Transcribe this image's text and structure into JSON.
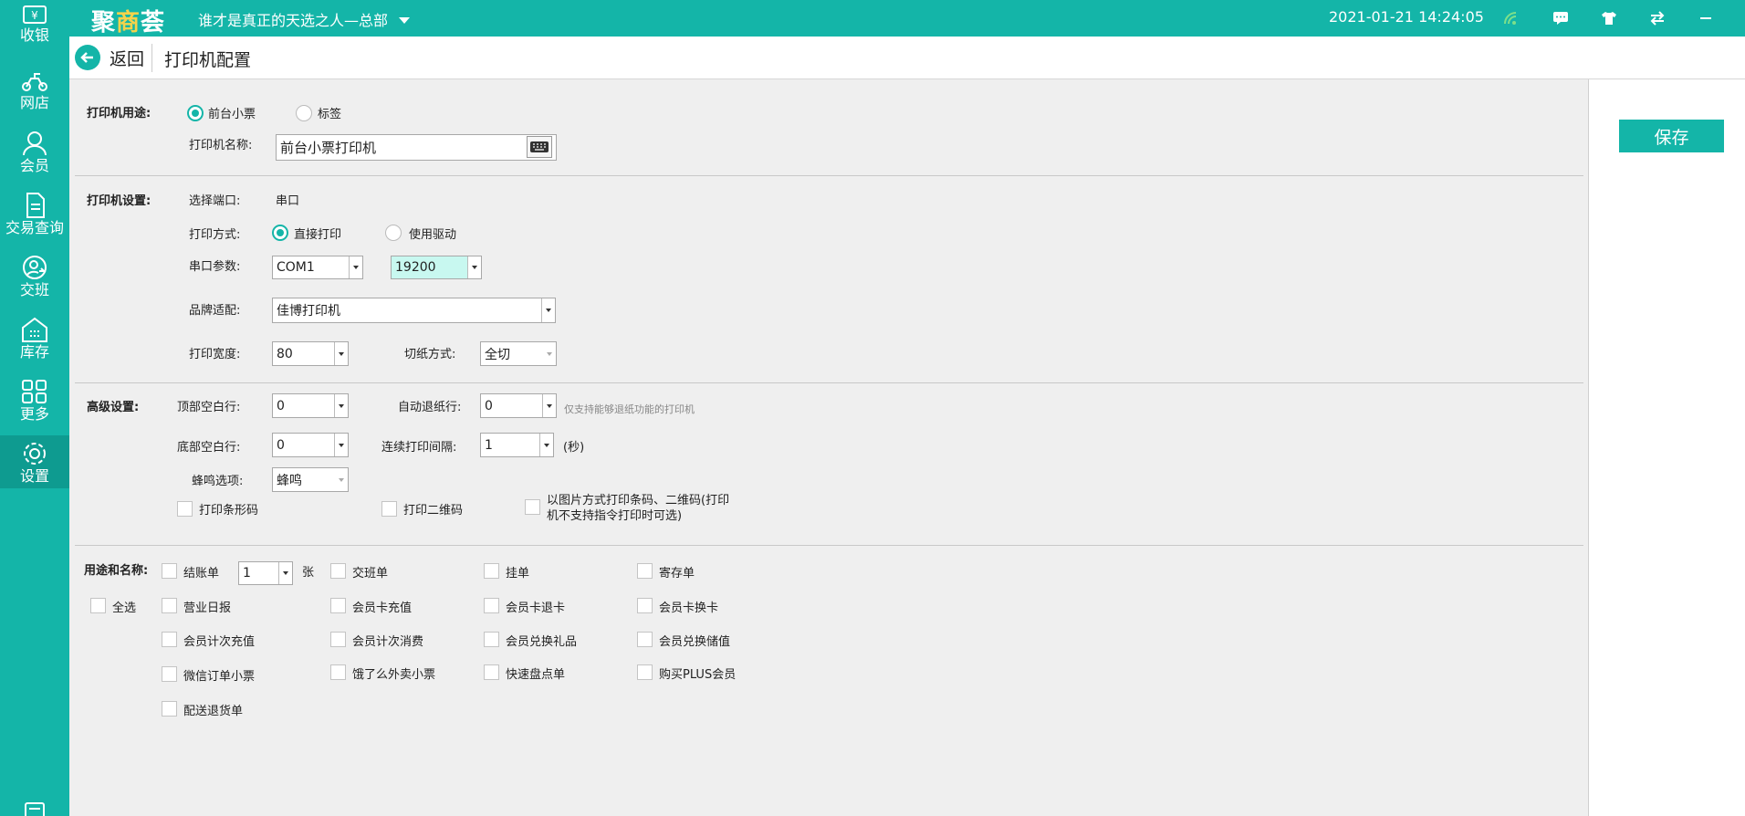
{
  "app": {
    "brand_a": "聚",
    "brand_b": "商",
    "brand_c": "荟",
    "store": "谁才是真正的天选之人—总部",
    "datetime": "2021-01-21 14:24:05"
  },
  "top_icons": [
    "wifi-icon",
    "message-icon",
    "shirt-icon",
    "swap-icon",
    "minimize-icon",
    "close-icon"
  ],
  "sidebar": {
    "items": [
      {
        "label": "收银",
        "icon": "cashier-icon"
      },
      {
        "label": "网店",
        "icon": "scooter-icon"
      },
      {
        "label": "会员",
        "icon": "user-icon"
      },
      {
        "label": "交易查询",
        "icon": "document-icon"
      },
      {
        "label": "交班",
        "icon": "shift-icon"
      },
      {
        "label": "库存",
        "icon": "warehouse-icon"
      },
      {
        "label": "更多",
        "icon": "grid-icon"
      },
      {
        "label": "设置",
        "icon": "gear-icon"
      }
    ]
  },
  "header": {
    "back": "返回",
    "title": "打印机配置"
  },
  "save": "保存",
  "usage": {
    "label": "打印机用途:",
    "opt1": "前台小票",
    "opt2": "标签",
    "name_label": "打印机名称:",
    "name_value": "前台小票打印机"
  },
  "settings": {
    "label": "打印机设置:",
    "port_label": "选择端口:",
    "port_value": "串口",
    "mode_label": "打印方式:",
    "mode_opt1": "直接打印",
    "mode_opt2": "使用驱动",
    "serial_label": "串口参数:",
    "serial_port": "COM1",
    "baud": "19200",
    "brand_label": "品牌适配:",
    "brand_value": "佳博打印机",
    "width_label": "打印宽度:",
    "width_value": "80",
    "cut_label": "切纸方式:",
    "cut_value": "全切"
  },
  "advanced": {
    "label": "高级设置:",
    "top_label": "顶部空白行:",
    "top_value": "0",
    "auto_label": "自动退纸行:",
    "auto_value": "0",
    "auto_note": "仅支持能够退纸功能的打印机",
    "bottom_label": "底部空白行:",
    "bottom_value": "0",
    "interval_label": "连续打印间隔:",
    "interval_value": "1",
    "interval_unit": "(秒)",
    "beep_label": "蜂鸣选项:",
    "beep_value": "蜂鸣",
    "barcode": "打印条形码",
    "qrcode": "打印二维码",
    "image_line1": "以图片方式打印条码、二维码(打印",
    "image_line2": "机不支持指令打印时可选)"
  },
  "purpose": {
    "label": "用途和名称:",
    "select_all": "全选",
    "copies_value": "1",
    "copies_unit": "张",
    "items": [
      "结账单",
      "交班单",
      "挂单",
      "寄存单",
      "营业日报",
      "会员卡充值",
      "会员卡退卡",
      "会员卡换卡",
      "会员计次充值",
      "会员计次消费",
      "会员兑换礼品",
      "会员兑换储值",
      "微信订单小票",
      "饿了么外卖小票",
      "快速盘点单",
      "购买PLUS会员",
      "配送退货单"
    ]
  },
  "colors": {
    "accent": "#14b5a8",
    "brand_highlight": "#f5d34a",
    "baud_bg": "#c8f8f0"
  }
}
